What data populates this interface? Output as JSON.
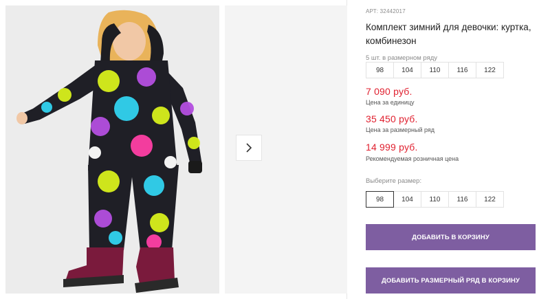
{
  "product": {
    "sku": "АРТ: 32442017",
    "title": "Комплект зимний для девочки: куртка, комбинезон",
    "pack_note": "5 шт. в размерном ряду",
    "pack_sizes": [
      "98",
      "104",
      "110",
      "116",
      "122"
    ],
    "price_unit": "7 090 руб.",
    "price_unit_label": "Цена за единицу",
    "price_pack": "35 450 руб.",
    "price_pack_label": "Цена за размерный ряд",
    "price_retail": "14 999 руб.",
    "price_retail_label": "Рекомендуемая розничная цена",
    "choose_size_label": "Выберите размер:",
    "size_options": [
      "98",
      "104",
      "110",
      "116",
      "122"
    ],
    "selected_size": "98",
    "add_to_cart": "Добавить в корзину",
    "add_pack_to_cart": "Добавить размерный ряд в корзину"
  },
  "colors": {
    "accent": "#7e5ea1",
    "price": "#e0202f"
  },
  "icons": {
    "next": "chevron-right-icon"
  }
}
